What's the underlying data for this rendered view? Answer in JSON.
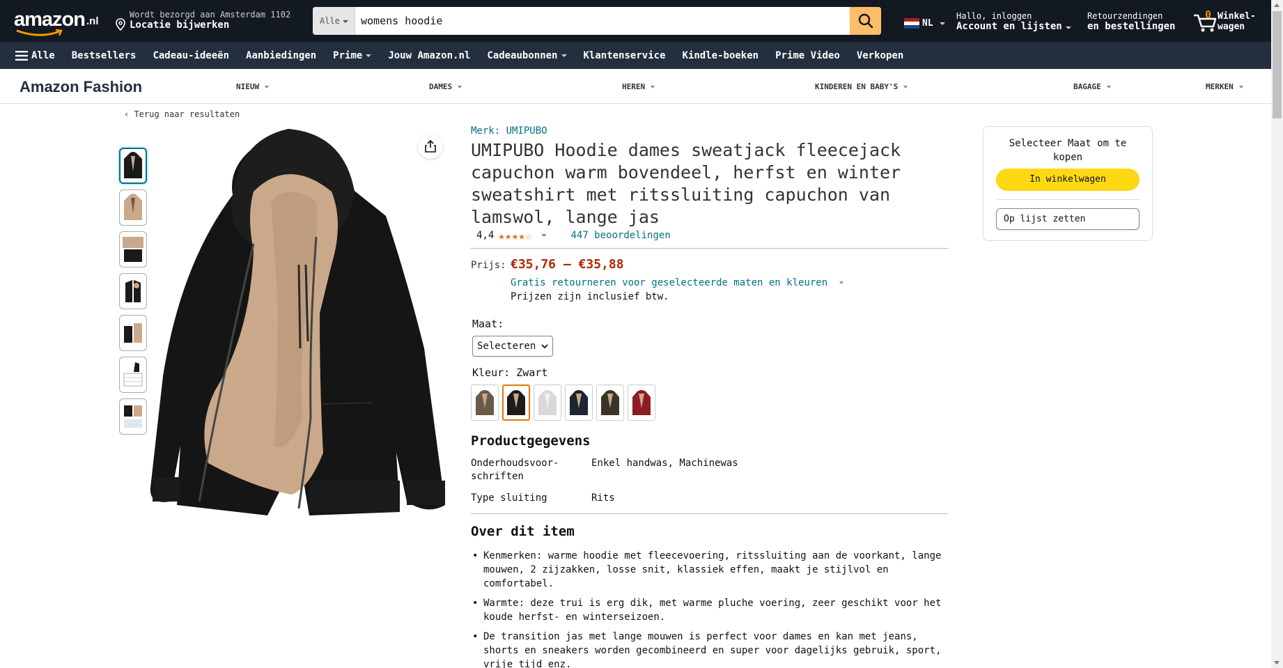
{
  "header": {
    "logo_text": "amazon",
    "logo_tld": ".nl",
    "deliver_line1": "Wordt bezorgd aan Amsterdam 1102",
    "deliver_line2": "Locatie bijwerken",
    "search_category": "Alle",
    "search_value": "womens hoodie",
    "language": "NL",
    "account_line1": "Hallo, inloggen",
    "account_line2": "Account en lijsten",
    "returns_line1": "Retourzendingen",
    "returns_line2": "en bestellingen",
    "cart_count": "0",
    "cart_label_1": "Winkel-",
    "cart_label_2": "wagen"
  },
  "subnav": {
    "all": "Alle",
    "items": [
      "Bestsellers",
      "Cadeau-ideeën",
      "Aanbiedingen",
      "Prime",
      "Jouw Amazon.nl",
      "Cadeaubonnen",
      "Klantenservice",
      "Kindle-boeken",
      "Prime Video",
      "Verkopen"
    ]
  },
  "fashion": {
    "brand": "Amazon Fashion",
    "items": [
      "NIEUW",
      "DAMES",
      "HEREN",
      "KINDEREN EN BABY'S",
      "BAGAGE",
      "MERKEN"
    ]
  },
  "back_link": "Terug naar resultaten",
  "product": {
    "brand": "Merk: UMIPUBO",
    "title": "UMIPUBO Hoodie dames sweatjack fleecejack capuchon warm bovendeel, herfst en winter sweatshirt met ritssluiting capuchon van lamswol, lange jas",
    "rating": "4,4",
    "stars": "★★★★☆",
    "reviews": "447 beoordelingen",
    "price_label": "Prijs:",
    "price": "€35,76 – €35,88",
    "returns": "Gratis retourneren voor geselecteerde maten en kleuren",
    "vat": "Prijzen zijn inclusief btw.",
    "size_label": "Maat:",
    "size_select": "Selecteren",
    "color_label": "Kleur: Zwart",
    "details_title": "Productgegevens",
    "specs": [
      {
        "k": "Onderhoudsvoor-schriften",
        "v": "Enkel handwas, Machinewas"
      },
      {
        "k": "Type sluiting",
        "v": "Rits"
      }
    ],
    "about_title": "Over dit item",
    "bullets": [
      "Kenmerken: warme hoodie met fleecevoering, ritssluiting aan de voorkant, lange mouwen, 2 zijzakken, losse snit, klassiek effen, maakt je stijlvol en comfortabel.",
      "Warmte: deze trui is erg dik, met warme pluche voering, zeer geschikt voor het koude herfst- en winterseizoen.",
      "De transition jas met lange mouwen is perfect voor dames en kan met jeans, shorts en sneakers worden gecombineerd en super voor dagelijks gebruik, sport, vrije tijd enz."
    ]
  },
  "buybox": {
    "title": "Selecteer Maat om te kopen",
    "cart_button": "In winkelwagen",
    "list_button": "Op lijst zetten"
  },
  "colors": {
    "nav_dark": "#131921",
    "nav_sub": "#232f3e",
    "link": "#007185",
    "price": "#b12704",
    "cart_button": "#ffd814",
    "search_button": "#febd69",
    "star": "#de7921"
  },
  "swatch_colors": [
    "#6b5a48",
    "#1c1c1c",
    "#d9d9d9",
    "#1d2433",
    "#3a3426",
    "#8e1b25"
  ]
}
